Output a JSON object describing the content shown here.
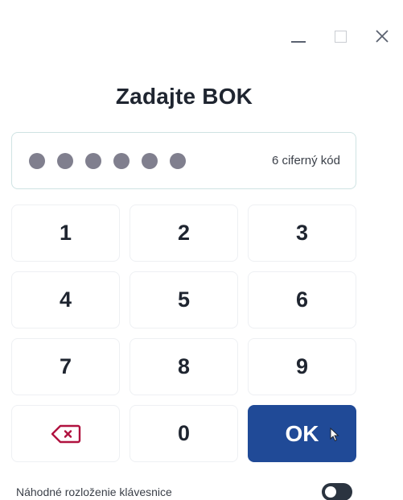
{
  "window": {
    "controls": [
      "minimize",
      "maximize",
      "close"
    ]
  },
  "dialog": {
    "title": "Zadajte BOK"
  },
  "pin": {
    "entered_digits": 6,
    "hint": "6 ciferný kód"
  },
  "keypad": {
    "keys": [
      "1",
      "2",
      "3",
      "4",
      "5",
      "6",
      "7",
      "8",
      "9",
      "",
      "0",
      "OK"
    ],
    "ok_label": "OK"
  },
  "footer": {
    "random_layout_label": "Náhodné rozloženie klávesnice",
    "random_layout_enabled": false
  },
  "colors": {
    "accent": "#204a97",
    "backspace_icon": "#b0123f",
    "dot": "#807f8e"
  },
  "icons": {
    "backspace": "backspace-icon",
    "cursor": "mouse-cursor-icon"
  }
}
